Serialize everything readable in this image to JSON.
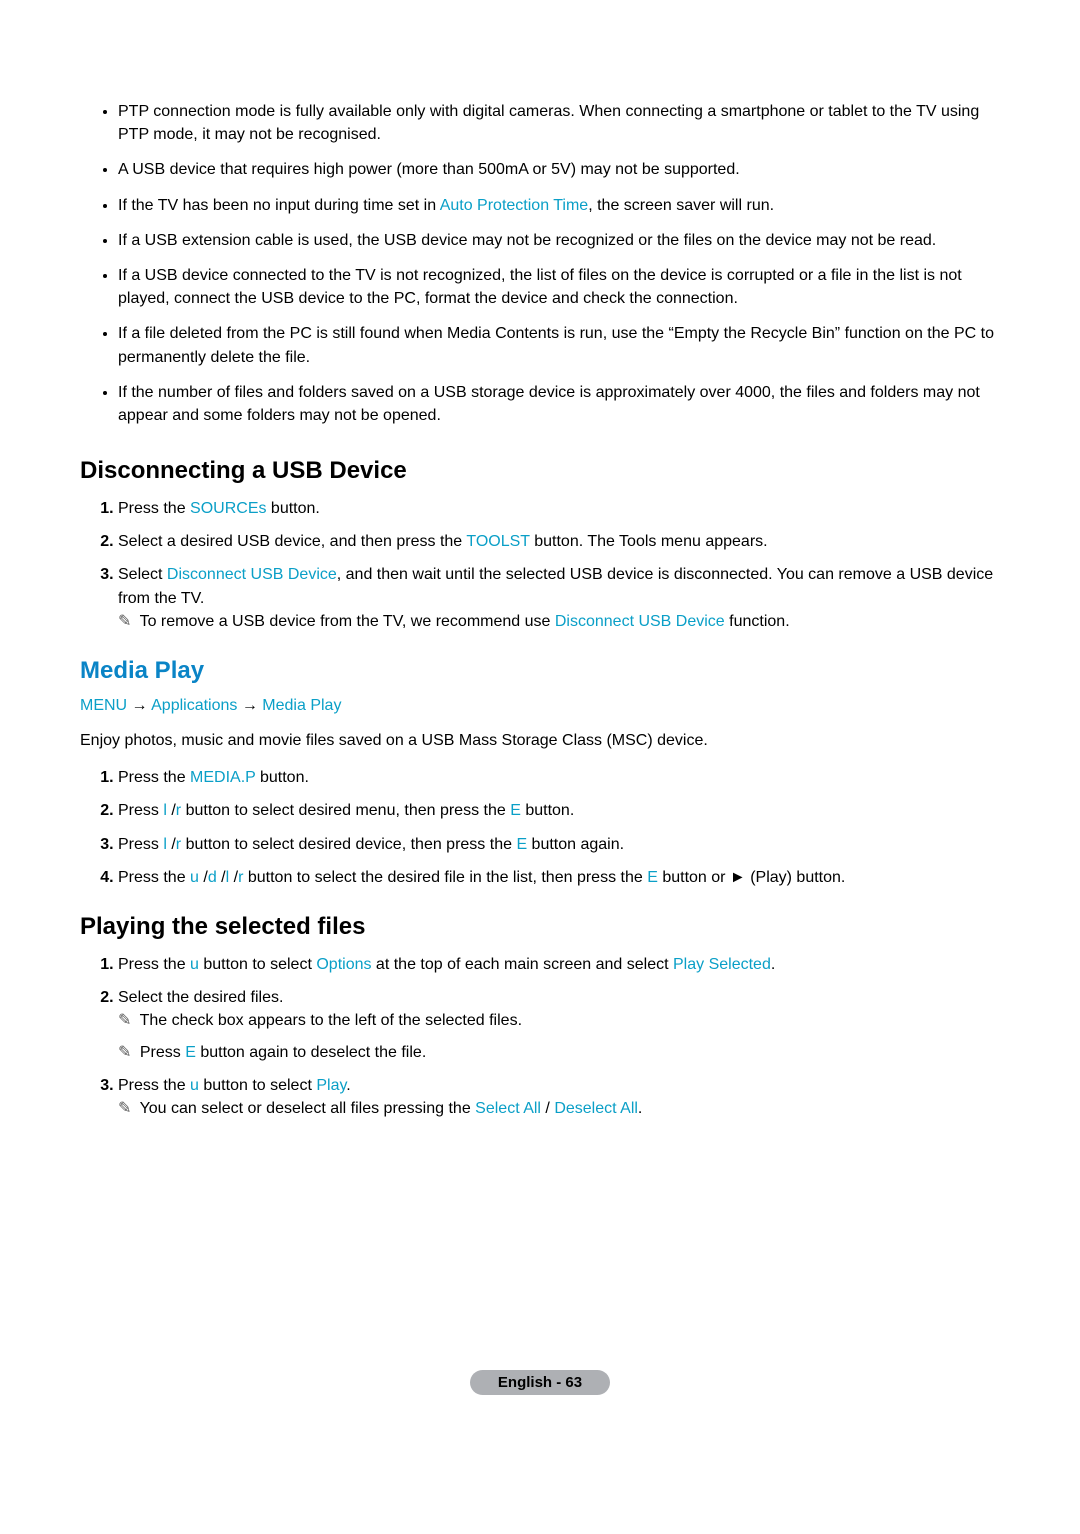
{
  "top_bullets": [
    {
      "text_before": "PTP connection mode is fully available only with digital cameras. When connecting a smartphone or tablet to the TV using PTP mode, it may not be recognised."
    },
    {
      "text_before": "A USB device that requires high power (more than 500mA or 5V) may not be supported."
    },
    {
      "text_before": "If the TV has been no input during time set in ",
      "cyan": "Auto Protection Time",
      "text_after": ", the screen saver will run."
    },
    {
      "text_before": "If a USB extension cable is used, the USB device may not be recognized or the files on the device may not be read."
    },
    {
      "text_before": "If a USB device connected to the TV is not recognized, the list of files on the device is corrupted or a file in the list is not played, connect the USB device to the PC, format the device and check the connection."
    },
    {
      "text_before": "If a file deleted from the PC is still found when Media Contents is run, use the “Empty the Recycle Bin” function on the PC to permanently delete the file."
    },
    {
      "text_before": "If the number of files and folders saved on a USB storage device is approximately over 4000, the files and folders may not appear and some folders may not be opened."
    }
  ],
  "disconnect": {
    "title": "Disconnecting a USB Device",
    "step1_a": "Press the ",
    "step1_cyan": "SOURCEs",
    "step1_b": " button.",
    "step2_a": "Select a desired USB device, and then press the ",
    "step2_cyan": "TOOLST",
    "step2_b": " button. The Tools menu appears.",
    "step3_a": "Select ",
    "step3_cyan": "Disconnect USB Device",
    "step3_b": ", and then wait until the selected USB device is disconnected. You can remove a USB device from the TV.",
    "note_a": "To remove a USB device from the TV, we recommend use ",
    "note_cyan": "Disconnect USB Device",
    "note_b": " function."
  },
  "media_play": {
    "title": "Media Play",
    "bc_menu": "MENU",
    "arrow": " → ",
    "bc_apps": "Applications",
    "bc_media": "Media Play",
    "intro": "Enjoy photos, music and movie files saved on a USB Mass Storage Class (MSC) device.",
    "step1_a": "Press the ",
    "step1_cyan": "MEDIA.P",
    "step1_b": " button.",
    "step2_a": "Press ",
    "step2_cyan1": "l",
    "step2_mid1": " /",
    "step2_cyan2": "r",
    "step2_b": " button to select desired menu, then press the ",
    "step2_cyan3": "E",
    "step2_c": " button.",
    "step3_a": "Press ",
    "step3_cyan1": "l",
    "step3_mid1": " /",
    "step3_cyan2": "r",
    "step3_b": " button to select desired device, then press the ",
    "step3_cyan3": "E",
    "step3_c": " button again.",
    "step4_a": "Press the ",
    "step4_cyan1": "u",
    "step4_m1": " /",
    "step4_cyan2": "d",
    "step4_m2": " /",
    "step4_cyan3": "l",
    "step4_m3": " /",
    "step4_cyan4": "r",
    "step4_b": " button to select the desired file in the list, then press the ",
    "step4_cyan5": "E",
    "step4_c": " button or ► (Play) button."
  },
  "playing": {
    "title": "Playing the selected files",
    "step1_a": "Press the ",
    "step1_cyan1": "u",
    "step1_b": " button to select ",
    "step1_cyan2": "Options",
    "step1_c": " at the top of each main screen and select ",
    "step1_cyan3": "Play Selected",
    "step1_d": ".",
    "step2": "Select the desired files.",
    "note1": "The check box appears to the left of the selected files.",
    "note2_a": "Press ",
    "note2_cyan": "E",
    "note2_b": " button again to deselect the file.",
    "step3_a": "Press the ",
    "step3_cyan1": "u",
    "step3_b": " button to select ",
    "step3_cyan2": "Play",
    "step3_c": ".",
    "note3_a": "You can select or deselect all files pressing the ",
    "note3_cyan1": "Select All",
    "note3_mid": " / ",
    "note3_cyan2": "Deselect All",
    "note3_b": "."
  },
  "footer": {
    "page_label": "English - 63"
  }
}
